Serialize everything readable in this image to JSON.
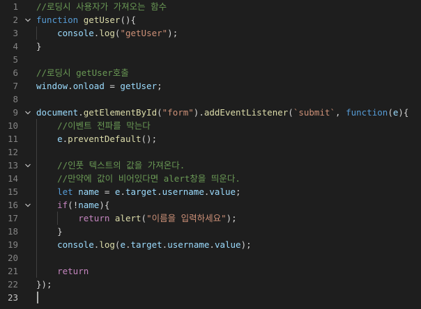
{
  "editor": {
    "lines": [
      {
        "num": "1",
        "fold": false,
        "tokens": [
          {
            "t": "//로딩시 사용자가 가져오는 함수",
            "c": "comment"
          }
        ]
      },
      {
        "num": "2",
        "fold": true,
        "tokens": [
          {
            "t": "function",
            "c": "keyword"
          },
          {
            "t": " ",
            "c": "punc"
          },
          {
            "t": "getUser",
            "c": "func"
          },
          {
            "t": "(){",
            "c": "punc"
          }
        ]
      },
      {
        "num": "3",
        "fold": false,
        "tokens": [
          {
            "t": "    ",
            "c": "punc"
          },
          {
            "t": "console",
            "c": "var"
          },
          {
            "t": ".",
            "c": "punc"
          },
          {
            "t": "log",
            "c": "func"
          },
          {
            "t": "(",
            "c": "punc"
          },
          {
            "t": "\"getUser\"",
            "c": "string"
          },
          {
            "t": ");",
            "c": "punc"
          }
        ]
      },
      {
        "num": "4",
        "fold": false,
        "tokens": [
          {
            "t": "}",
            "c": "punc"
          }
        ]
      },
      {
        "num": "5",
        "fold": false,
        "tokens": []
      },
      {
        "num": "6",
        "fold": false,
        "tokens": [
          {
            "t": "//로딩시 getUser호출",
            "c": "comment"
          }
        ]
      },
      {
        "num": "7",
        "fold": false,
        "tokens": [
          {
            "t": "window",
            "c": "var"
          },
          {
            "t": ".",
            "c": "punc"
          },
          {
            "t": "onload",
            "c": "prop"
          },
          {
            "t": " = ",
            "c": "punc"
          },
          {
            "t": "getUser",
            "c": "var"
          },
          {
            "t": ";",
            "c": "punc"
          }
        ]
      },
      {
        "num": "8",
        "fold": false,
        "tokens": []
      },
      {
        "num": "9",
        "fold": true,
        "tokens": [
          {
            "t": "document",
            "c": "var"
          },
          {
            "t": ".",
            "c": "punc"
          },
          {
            "t": "getElementById",
            "c": "func"
          },
          {
            "t": "(",
            "c": "punc"
          },
          {
            "t": "\"form\"",
            "c": "string"
          },
          {
            "t": ").",
            "c": "punc"
          },
          {
            "t": "addEventListener",
            "c": "func"
          },
          {
            "t": "(",
            "c": "punc"
          },
          {
            "t": "`submit`",
            "c": "string"
          },
          {
            "t": ", ",
            "c": "punc"
          },
          {
            "t": "function",
            "c": "keyword"
          },
          {
            "t": "(",
            "c": "punc"
          },
          {
            "t": "e",
            "c": "param"
          },
          {
            "t": "){",
            "c": "punc"
          }
        ]
      },
      {
        "num": "10",
        "fold": false,
        "tokens": [
          {
            "t": "    ",
            "c": "punc"
          },
          {
            "t": "//이벤트 전파를 막는다",
            "c": "comment"
          }
        ]
      },
      {
        "num": "11",
        "fold": false,
        "tokens": [
          {
            "t": "    ",
            "c": "punc"
          },
          {
            "t": "e",
            "c": "param"
          },
          {
            "t": ".",
            "c": "punc"
          },
          {
            "t": "preventDefault",
            "c": "func"
          },
          {
            "t": "();",
            "c": "punc"
          }
        ]
      },
      {
        "num": "12",
        "fold": false,
        "tokens": []
      },
      {
        "num": "13",
        "fold": true,
        "tokens": [
          {
            "t": "    ",
            "c": "punc"
          },
          {
            "t": "//인풋 텍스트의 값을 가져온다.",
            "c": "comment"
          }
        ]
      },
      {
        "num": "14",
        "fold": false,
        "tokens": [
          {
            "t": "    ",
            "c": "punc"
          },
          {
            "t": "//만약에 값이 비어있다면 alert창을 띄운다.",
            "c": "comment"
          }
        ]
      },
      {
        "num": "15",
        "fold": false,
        "tokens": [
          {
            "t": "    ",
            "c": "punc"
          },
          {
            "t": "let",
            "c": "keyword"
          },
          {
            "t": " ",
            "c": "punc"
          },
          {
            "t": "name",
            "c": "var"
          },
          {
            "t": " = ",
            "c": "punc"
          },
          {
            "t": "e",
            "c": "param"
          },
          {
            "t": ".",
            "c": "punc"
          },
          {
            "t": "target",
            "c": "prop"
          },
          {
            "t": ".",
            "c": "punc"
          },
          {
            "t": "username",
            "c": "prop"
          },
          {
            "t": ".",
            "c": "punc"
          },
          {
            "t": "value",
            "c": "prop"
          },
          {
            "t": ";",
            "c": "punc"
          }
        ]
      },
      {
        "num": "16",
        "fold": true,
        "tokens": [
          {
            "t": "    ",
            "c": "punc"
          },
          {
            "t": "if",
            "c": "control"
          },
          {
            "t": "(!",
            "c": "punc"
          },
          {
            "t": "name",
            "c": "var"
          },
          {
            "t": "){",
            "c": "punc"
          }
        ]
      },
      {
        "num": "17",
        "fold": false,
        "tokens": [
          {
            "t": "        ",
            "c": "punc"
          },
          {
            "t": "return",
            "c": "control"
          },
          {
            "t": " ",
            "c": "punc"
          },
          {
            "t": "alert",
            "c": "func"
          },
          {
            "t": "(",
            "c": "punc"
          },
          {
            "t": "\"이름을 입력하세요\"",
            "c": "string"
          },
          {
            "t": ");",
            "c": "punc"
          }
        ]
      },
      {
        "num": "18",
        "fold": false,
        "tokens": [
          {
            "t": "    ",
            "c": "punc"
          },
          {
            "t": "}",
            "c": "punc"
          }
        ]
      },
      {
        "num": "19",
        "fold": false,
        "tokens": [
          {
            "t": "    ",
            "c": "punc"
          },
          {
            "t": "console",
            "c": "var"
          },
          {
            "t": ".",
            "c": "punc"
          },
          {
            "t": "log",
            "c": "func"
          },
          {
            "t": "(",
            "c": "punc"
          },
          {
            "t": "e",
            "c": "param"
          },
          {
            "t": ".",
            "c": "punc"
          },
          {
            "t": "target",
            "c": "prop"
          },
          {
            "t": ".",
            "c": "punc"
          },
          {
            "t": "username",
            "c": "prop"
          },
          {
            "t": ".",
            "c": "punc"
          },
          {
            "t": "value",
            "c": "prop"
          },
          {
            "t": ");",
            "c": "punc"
          }
        ]
      },
      {
        "num": "20",
        "fold": false,
        "tokens": []
      },
      {
        "num": "21",
        "fold": false,
        "tokens": [
          {
            "t": "    ",
            "c": "punc"
          },
          {
            "t": "return",
            "c": "control"
          }
        ]
      },
      {
        "num": "22",
        "fold": false,
        "tokens": [
          {
            "t": "});",
            "c": "punc"
          }
        ]
      },
      {
        "num": "23",
        "fold": false,
        "current": true,
        "tokens": []
      }
    ]
  }
}
